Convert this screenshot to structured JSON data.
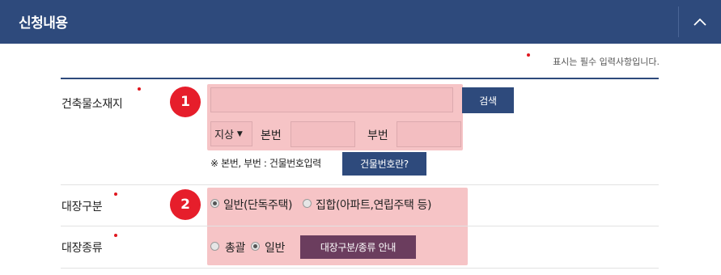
{
  "header": {
    "title": "신청내용"
  },
  "required_note": "표시는 필수 입력사항입니다.",
  "badges": [
    "1",
    "2"
  ],
  "location": {
    "label": "건축물소재지",
    "search_button": "검색",
    "select_value": "지상",
    "bonbeon_label": "본번",
    "bubeon_label": "부번",
    "hint": "※ 본번, 부번 : 건물번호입력",
    "building_no_button": "건물번호란?"
  },
  "ledger_type": {
    "label": "대장구분",
    "options": [
      {
        "label": "일반(단독주택)",
        "checked": true
      },
      {
        "label": "집합(아파트,연립주택 등)",
        "checked": false
      }
    ]
  },
  "ledger_kind": {
    "label": "대장종류",
    "options": [
      {
        "label": "총괄",
        "checked": false
      },
      {
        "label": "일반",
        "checked": true
      }
    ],
    "guide_button": "대장구분/종류 안내"
  },
  "colors": {
    "header": "#2e4a7c",
    "highlight": "#f6c4c6",
    "badge": "#e61e2b",
    "guide_button": "#6b3d5e"
  },
  "icons": {
    "collapse": "chevron-up-icon",
    "required_marker": "red-dot-icon"
  }
}
